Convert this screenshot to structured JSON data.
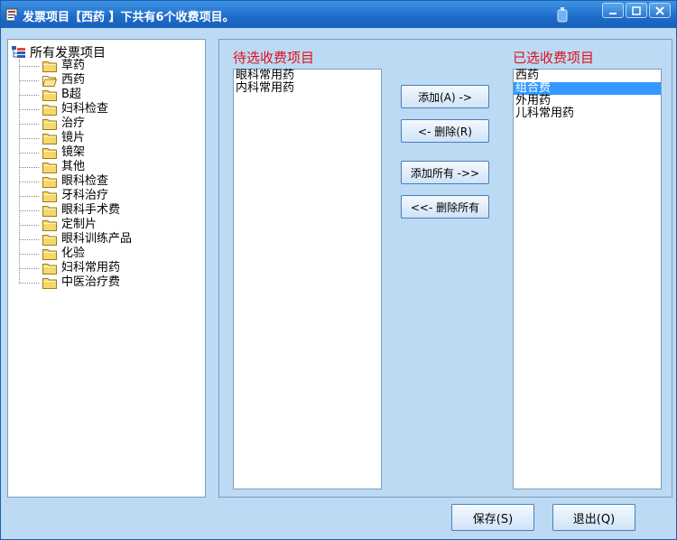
{
  "window": {
    "title": "发票项目【西药 】下共有6个收费项目。"
  },
  "tree": {
    "root_label": "所有发票项目",
    "items": [
      {
        "label": "草药",
        "open": false
      },
      {
        "label": "西药",
        "open": true
      },
      {
        "label": "B超",
        "open": false
      },
      {
        "label": "妇科检查",
        "open": false
      },
      {
        "label": "治疗",
        "open": false
      },
      {
        "label": "镜片",
        "open": false
      },
      {
        "label": "镜架",
        "open": false
      },
      {
        "label": "其他",
        "open": false
      },
      {
        "label": "眼科检查",
        "open": false
      },
      {
        "label": "牙科治疗",
        "open": false
      },
      {
        "label": "眼科手术费",
        "open": false
      },
      {
        "label": "定制片",
        "open": false
      },
      {
        "label": "眼科训练产品",
        "open": false
      },
      {
        "label": "化验",
        "open": false
      },
      {
        "label": "妇科常用药",
        "open": false
      },
      {
        "label": "中医治疗费",
        "open": false
      }
    ]
  },
  "pending": {
    "title": "待选收费项目",
    "items": [
      "眼科常用药",
      "内科常用药"
    ]
  },
  "selected": {
    "title": "已选收费项目",
    "items": [
      "西药",
      "组合费",
      "外用药",
      "儿科常用药"
    ],
    "selected_index": 1
  },
  "buttons": {
    "add": "添加(A) ->",
    "remove": "<-  删除(R)",
    "add_all": "添加所有 ->>",
    "remove_all": "<<-  删除所有",
    "save": "保存(S)",
    "exit": "退出(Q)"
  },
  "colors": {
    "title_bar": "#1d6cc9",
    "window_bg": "#bcdaf4",
    "section_title": "#e0101a",
    "selection": "#3399ff"
  }
}
